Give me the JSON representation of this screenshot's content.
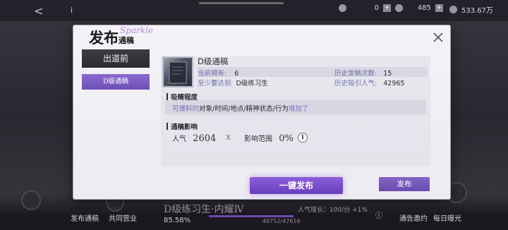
{
  "background": {
    "resources": [
      {
        "icon": "coin-icon",
        "value": "0"
      },
      {
        "icon": "gem-icon",
        "value": "485"
      },
      {
        "icon": "gold-icon",
        "value": "533.67万"
      }
    ],
    "bottom_nav": {
      "publish": "发布通稿",
      "shared": "共同营业",
      "trainee_title": "D级练习生·内耀Ⅳ",
      "trainee_pct": "85.58%",
      "exp": "40752/47616",
      "popularity": "人气增长：100/分 +1%",
      "notice": "通告邀约",
      "exposure": "每日曝光"
    }
  },
  "dialog": {
    "title_big": "发布",
    "title_small": "通稿",
    "title_script": "Sparkle",
    "sidebar": {
      "header": "出道前",
      "item": "D级通稿"
    },
    "item": {
      "name": "D级通稿",
      "owned_label": "当前拥有:",
      "owned_value": "6",
      "history_count_label": "历史发稿次数:",
      "history_count_value": "15",
      "requirement_label": "至少要达到",
      "requirement_value": "D级练习生",
      "history_pop_label": "历史吸引人气:",
      "history_pop_value": "42965"
    },
    "attract": {
      "heading": "吸睛程度",
      "prefix": "可爆料的",
      "targets": "对象/时间/地点/精神状态/行为",
      "suffix": "增加了"
    },
    "impact": {
      "heading": "通稿影响",
      "pop_label": "人气",
      "pop_value": "2604",
      "separator": "X",
      "range_label": "影响范围",
      "range_value": "0%",
      "info": "i"
    },
    "publish_button": "发布",
    "one_click_button": "一键发布"
  }
}
